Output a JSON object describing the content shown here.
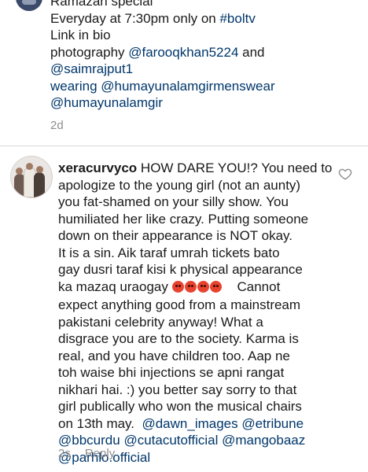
{
  "caption": {
    "lines": [
      "Ramazan special",
      "Everyday at 7:30pm only on ",
      "Link in bio",
      "photography ",
      "@saimrajput1",
      "wearing @humayunalamgirmenswear",
      "@humayunalamgir"
    ],
    "hashtag": "#boltv",
    "photographer_mention": "@farooqkhan5224",
    "photographer_and": " and",
    "time": "2d"
  },
  "comment": {
    "username": "xeracurvyco",
    "lines": [
      " HOW DARE YOU!? You need to",
      "apologize to the young girl (not an aunty)",
      "you fat-shamed on your silly show. You",
      "humiliated her like crazy. Putting someone",
      "down on their appearance is NOT okay.",
      "It is a sin. Aik taraf umrah tickets bato",
      "gay dusri taraf kisi k physical appearance",
      "ka mazaq uraogay ",
      "    Cannot",
      "expect anything good from a mainstream",
      "pakistani celebrity anyway! What a",
      "disgrace you are to the society. Karma is",
      "real, and you have children too. Aap ne",
      "toh waise bhi injections se apni rangat",
      "nikhari hai. :)  you better say sorry to that",
      "girl publically who won the musical chairs",
      "on 13th may.  "
    ],
    "mentions": [
      "@dawn_images",
      "@etribune",
      "@bbcurdu",
      "@cutacutofficial",
      "@mangobaaz",
      "@parhlo.official"
    ],
    "emojis": [
      "angry-face",
      "angry-face",
      "angry-face",
      "angry-face"
    ],
    "time": "2s",
    "reply_label": "Reply"
  },
  "colors": {
    "mention": "#00376b",
    "meta": "#8e8e8e",
    "text": "#1a1a1a"
  }
}
